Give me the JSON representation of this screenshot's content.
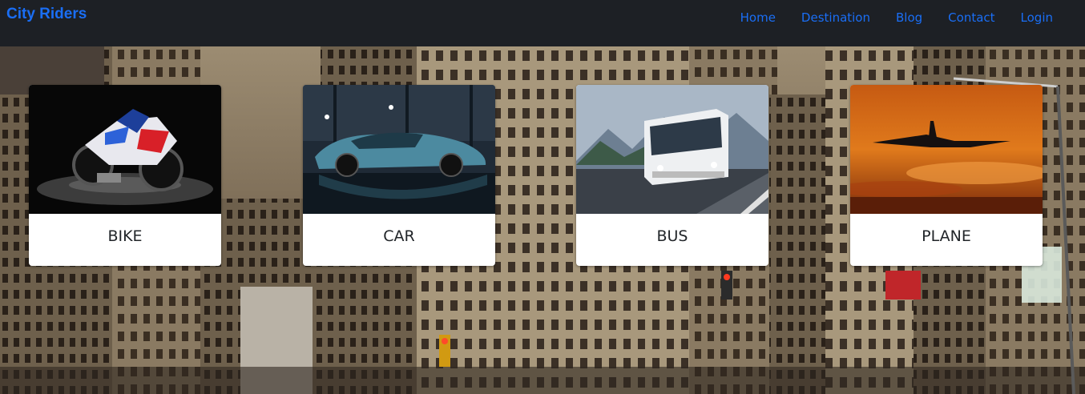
{
  "navbar": {
    "brand": "City Riders",
    "links": [
      "Home",
      "Destination",
      "Blog",
      "Contact",
      "Login"
    ]
  },
  "cards": [
    {
      "title": "BIKE",
      "image": "motorcycle-photo"
    },
    {
      "title": "CAR",
      "image": "sports-car-photo"
    },
    {
      "title": "BUS",
      "image": "coach-bus-photo"
    },
    {
      "title": "PLANE",
      "image": "airplane-sunset-photo"
    }
  ],
  "colors": {
    "navbar_bg": "#1d2025",
    "link": "#1a6ef5",
    "card_bg": "#ffffff",
    "card_text": "#212529"
  }
}
